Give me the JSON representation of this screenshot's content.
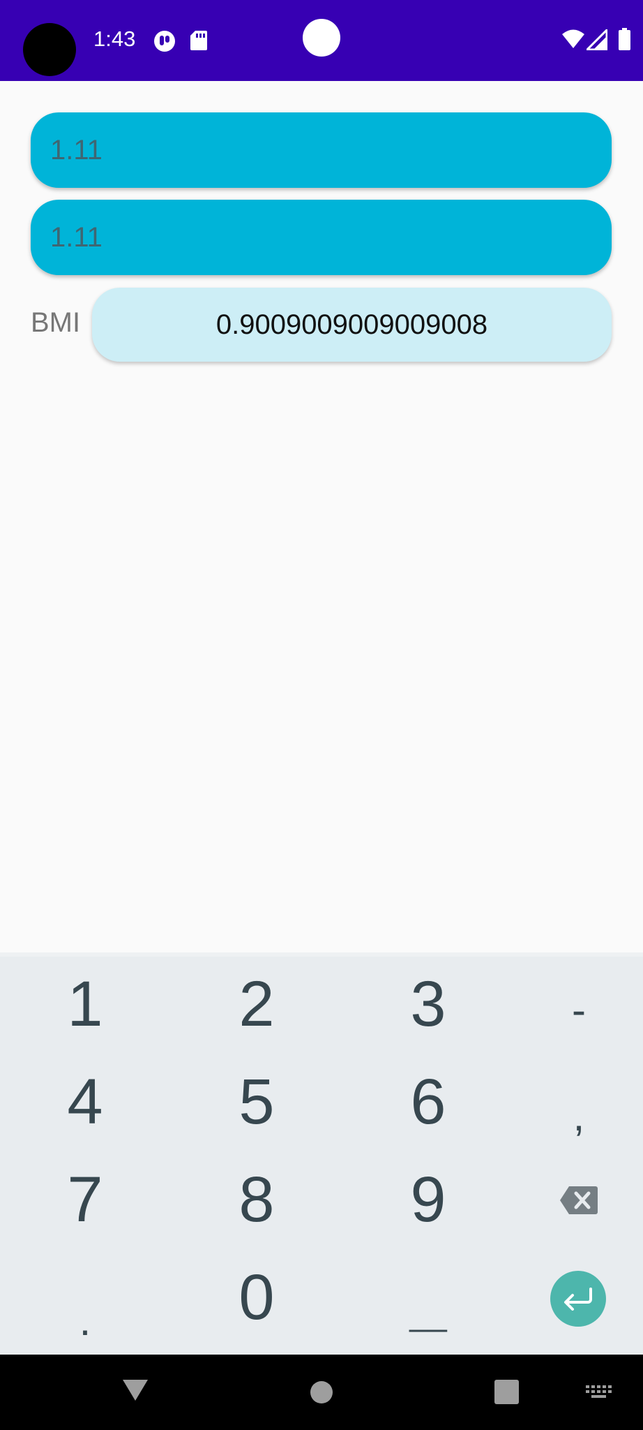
{
  "status_bar": {
    "time": "1:43",
    "icons": [
      "notification-app-icon",
      "sd-card-icon",
      "wifi-icon",
      "signal-icon",
      "battery-icon"
    ],
    "background_color": "#3700b3"
  },
  "form": {
    "weight_value": "1.11",
    "height_value": "1.11",
    "bmi_label": "BMI",
    "bmi_result": "0.9009009009009008",
    "field_color": "#00b4d8",
    "result_color": "#cdeef6"
  },
  "keyboard": {
    "keys": {
      "k1": "1",
      "k2": "2",
      "k3": "3",
      "minus": "-",
      "k4": "4",
      "k5": "5",
      "k6": "6",
      "comma": ",",
      "k7": "7",
      "k8": "8",
      "k9": "9",
      "dot": ".",
      "k0": "0",
      "space": "__"
    },
    "enter_color": "#4db6ac"
  },
  "nav_bar": {
    "icons": [
      "back-icon",
      "home-icon",
      "recents-icon",
      "keyboard-switch-icon"
    ]
  }
}
